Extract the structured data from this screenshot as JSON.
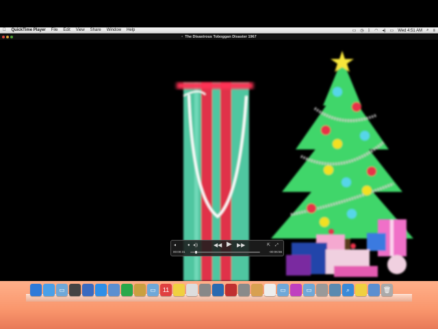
{
  "menubar": {
    "apple_icon": "apple-icon",
    "app_name": "QuickTime Player",
    "menus": [
      "File",
      "Edit",
      "View",
      "Share",
      "Window",
      "Help"
    ],
    "status_icons": [
      "display-icon",
      "time-machine-icon",
      "bluetooth-icon",
      "wifi-icon",
      "volume-icon",
      "battery-icon"
    ],
    "clock": "Wed 4:51 AM"
  },
  "window": {
    "title": "The Disastrous Toboggan Disaster 1967"
  },
  "player": {
    "current_time": "00:00:31",
    "remaining_time": "-00:06:56",
    "progress": 0.07,
    "volume": 0.5
  },
  "dock": {
    "items": [
      "finder-icon",
      "app-store-icon",
      "folder-icon",
      "dashboard-icon",
      "preview-icon",
      "safari-icon",
      "mail-icon",
      "facetime-icon",
      "photo-icon",
      "folder-icon",
      "calendar-icon",
      "notes-icon",
      "textedit-icon",
      "time-machine-icon",
      "quicktime-icon",
      "photo-booth-icon",
      "system-preferences-icon",
      "photos-icon",
      "document-icon",
      "folder-icon",
      "itunes-icon",
      "folder-icon",
      "script-editor-icon",
      "image-icon",
      "search-icon",
      "notes-icon",
      "mail-icon",
      "trash-icon"
    ]
  }
}
